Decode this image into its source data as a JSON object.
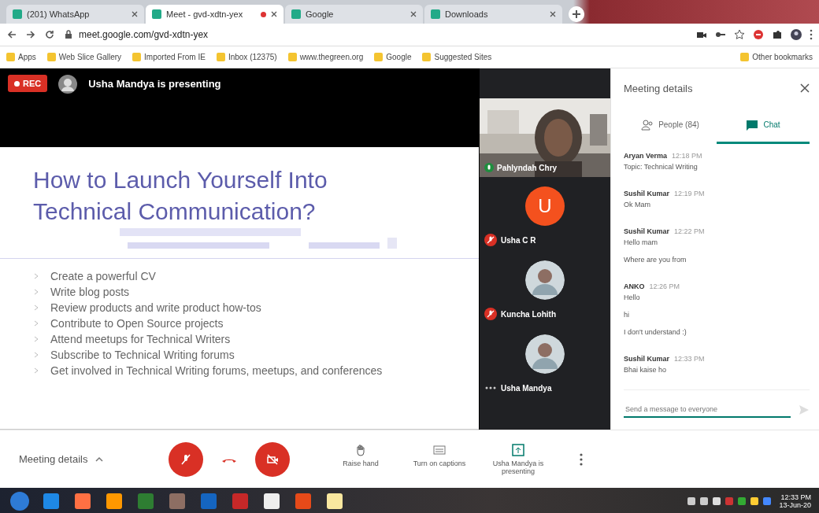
{
  "browser": {
    "tabs": [
      {
        "title": "(201) WhatsApp",
        "selected": false,
        "recording": false
      },
      {
        "title": "Meet - gvd-xdtn-yex",
        "selected": true,
        "recording": true
      },
      {
        "title": "Google",
        "selected": false,
        "recording": false
      },
      {
        "title": "Downloads",
        "selected": false,
        "recording": false
      }
    ],
    "url": "meet.google.com/gvd-xdtn-yex",
    "bookmarks": [
      "Apps",
      "Web Slice Gallery",
      "Imported From IE",
      "Inbox (12375)",
      "www.thegreen.org",
      "Google",
      "Suggested Sites"
    ],
    "other_bookmarks": "Other bookmarks"
  },
  "recording_badge": "REC",
  "presenter_banner": "Usha Mandya is presenting",
  "slide": {
    "title": "How to Launch Yourself Into Technical Communication?",
    "bullets": [
      "Create a powerful CV",
      "Write blog posts",
      "Review products and write product how-tos",
      "Contribute to Open Source projects",
      "Attend meetups for Technical Writers",
      "Subscribe to Technical Writing forums",
      "Get involved in Technical Writing forums, meetups, and conferences"
    ]
  },
  "participants": [
    {
      "kind": "video",
      "name": "Pahlyndah Chry",
      "muted": false
    },
    {
      "kind": "letter",
      "initial": "U",
      "name": "Usha C R",
      "muted": true
    },
    {
      "name": "Kuncha Lohith",
      "muted": true
    },
    {
      "name": "Usha Mandya",
      "muted": false,
      "menu": true
    }
  ],
  "panel": {
    "title": "Meeting details",
    "tabs": [
      {
        "label": "People (84)",
        "selected": false
      },
      {
        "label": "Chat",
        "selected": true
      }
    ],
    "messages": [
      {
        "sender": "Aryan Verma",
        "time": "12:18 PM",
        "lines": [
          "Topic: Technical Writing"
        ]
      },
      {
        "sender": "Sushil Kumar",
        "time": "12:19 PM",
        "lines": [
          "Ok Mam"
        ]
      },
      {
        "sender": "Sushil Kumar",
        "time": "12:22 PM",
        "lines": [
          "Hello mam",
          "Where are you from"
        ]
      },
      {
        "sender": "ANKO",
        "time": "12:26 PM",
        "lines": [
          "Hello",
          "hi",
          "I don't understand :)"
        ]
      },
      {
        "sender": "Sushil Kumar",
        "time": "12:33 PM",
        "lines": [
          "Bhai kaise ho"
        ]
      }
    ],
    "input": {
      "placeholder": "Send a message to everyone"
    }
  },
  "controls": {
    "details": "Meeting details",
    "mic_off": true,
    "camera_off": true,
    "actions": [
      {
        "kind": "hand",
        "label": "Raise hand"
      },
      {
        "kind": "captions",
        "label": "Turn on captions"
      },
      {
        "kind": "present",
        "label": "Usha Mandya is presenting"
      }
    ]
  },
  "taskbar": {
    "time": "12:33 PM",
    "date": "13-Jun-20"
  }
}
